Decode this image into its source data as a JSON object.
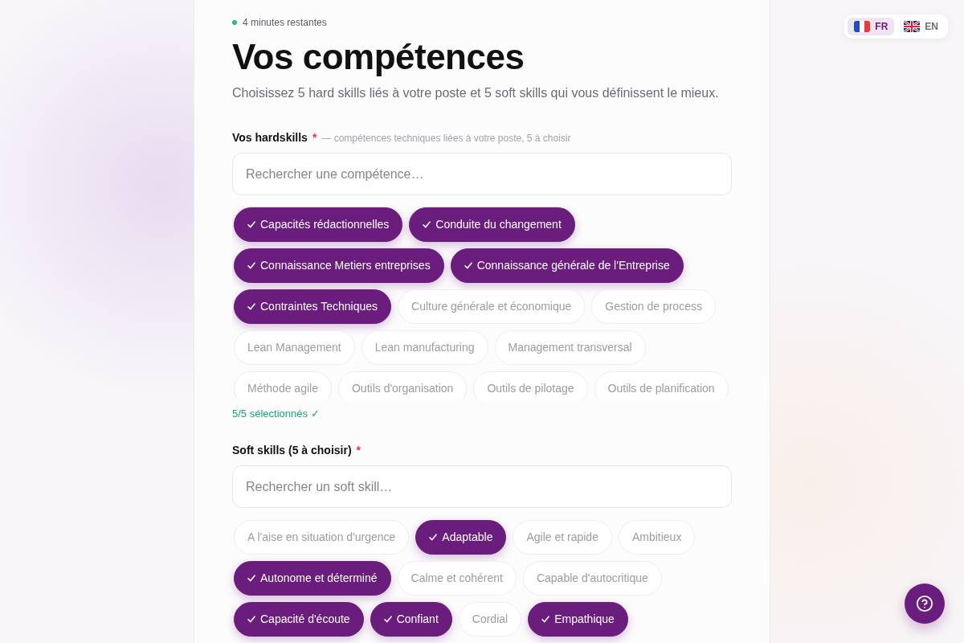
{
  "timer": {
    "text": "4 minutes restantes"
  },
  "title": "Vos compétences",
  "subtitle": "Choisissez 5 hard skills liés à votre poste et 5 soft skills qui vous définissent le mieux.",
  "language_switcher": [
    {
      "kind": "french",
      "label": "FR",
      "selected": true
    },
    {
      "kind": "british",
      "label": "EN",
      "selected": false
    }
  ],
  "hardskills": {
    "label": "Vos hardskills",
    "required_mark": "*",
    "hint": "— compétences techniques liées à votre poste, 5 à choisir",
    "search": {
      "placeholder": "Rechercher une compétence…"
    },
    "chips": [
      {
        "label": "Capacités rédactionnelles",
        "selected": true
      },
      {
        "label": "Conduite du changement",
        "selected": true
      },
      {
        "label": "Connaissance Metiers entreprises",
        "selected": true
      },
      {
        "label": "Connaissance générale de l'Entreprise",
        "selected": true
      },
      {
        "label": "Contraintes Techniques",
        "selected": true
      },
      {
        "label": "Culture générale et économique",
        "selected": false
      },
      {
        "label": "Gestion de process",
        "selected": false
      },
      {
        "label": "Lean Management",
        "selected": false
      },
      {
        "label": "Lean manufacturing",
        "selected": false
      },
      {
        "label": "Management transversal",
        "selected": false
      },
      {
        "label": "Méthode agile",
        "selected": false
      },
      {
        "label": "Outils d'organisation",
        "selected": false
      },
      {
        "label": "Outils de pilotage",
        "selected": false
      },
      {
        "label": "Outils de planification",
        "selected": false
      }
    ],
    "counter": "5/5 sélectionnés ✓"
  },
  "softskills": {
    "label": "Soft skills (5 à choisir)",
    "required_mark": "*",
    "search": {
      "placeholder": "Rechercher un soft skill…"
    },
    "chips": [
      {
        "label": "A l'aise en situation d'urgence",
        "selected": false
      },
      {
        "label": "Adaptable",
        "selected": true
      },
      {
        "label": "Agile et rapide",
        "selected": false
      },
      {
        "label": "Ambitieux",
        "selected": false
      },
      {
        "label": "Autonome et déterminé",
        "selected": true
      },
      {
        "label": "Calme et cohérent",
        "selected": false
      },
      {
        "label": "Capable d'autocritique",
        "selected": false
      },
      {
        "label": "Capacité d'écoute",
        "selected": true
      },
      {
        "label": "Confiant",
        "selected": true
      },
      {
        "label": "Cordial",
        "selected": false
      },
      {
        "label": "Empathique",
        "selected": true
      }
    ]
  }
}
